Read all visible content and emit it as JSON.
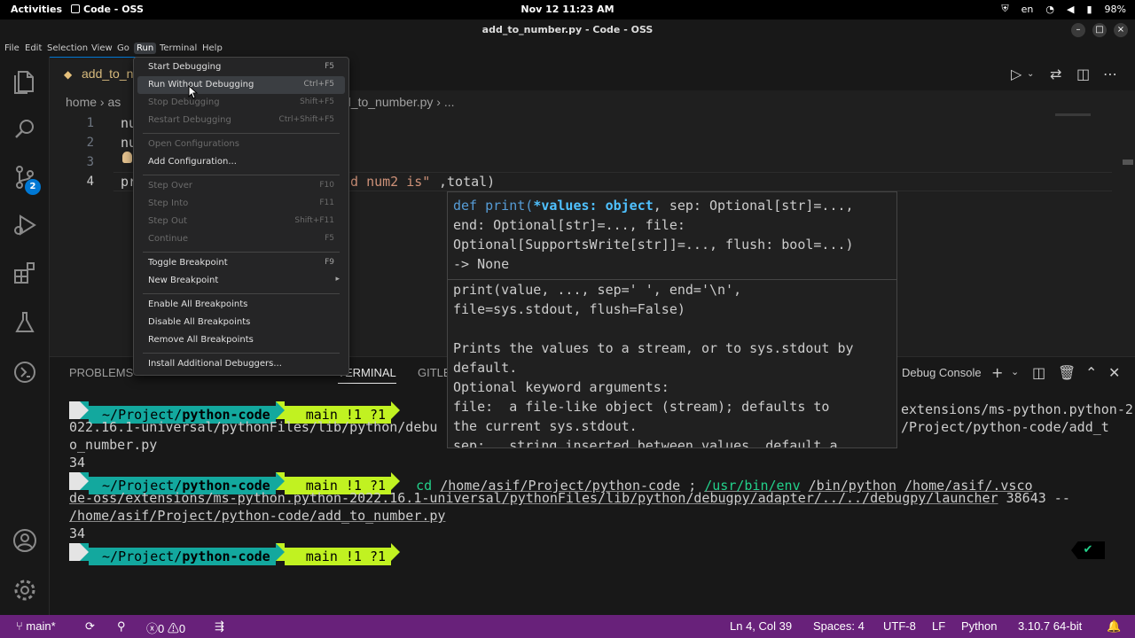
{
  "topbar": {
    "activities": "Activities",
    "app_name": "Code - OSS",
    "clock": "Nov 12  11:23 AM",
    "lang": "en",
    "battery": "98%"
  },
  "window": {
    "title": "add_to_number.py - Code - OSS",
    "minimize": "–",
    "maximize": "□",
    "close": "×"
  },
  "menubar": {
    "items": [
      "File",
      "Edit",
      "Selection",
      "View",
      "Go",
      "Run",
      "Terminal",
      "Help"
    ],
    "active": "Run"
  },
  "activitybar": {
    "scm_badge": "2"
  },
  "editor": {
    "tab_label": "add_to_n",
    "breadcrumb_home": "home",
    "breadcrumb_sep": "›",
    "breadcrumb_part": "as",
    "breadcrumb_file": "d_to_number.py",
    "breadcrumb_more": "...",
    "lines": [
      {
        "num": "1",
        "text": "nu"
      },
      {
        "num": "2",
        "text": "nu"
      },
      {
        "num": "3",
        "text": ""
      },
      {
        "num": "4",
        "text_start": "pr",
        "string_part": "nd num2 is\"",
        "rest": ",total)"
      }
    ]
  },
  "hover": {
    "sig_line1_a": "def print(",
    "sig_param": "*values: object",
    "sig_line1_b": ", sep: Optional[str]=...,",
    "sig_line2": "end: Optional[str]=..., file:",
    "sig_line3": "Optional[SupportsWrite[str]]=..., flush: bool=...)",
    "sig_line4": "-> None",
    "doc_lines": [
      "print(value, ..., sep=' ', end='\\n',",
      "file=sys.stdout, flush=False)",
      "",
      "Prints the values to a stream, or to sys.stdout by",
      "default.",
      "Optional keyword arguments:",
      "file:  a file-like object (stream); defaults to",
      "the current sys.stdout.",
      "sep:   string inserted between values, default a"
    ]
  },
  "panel": {
    "tabs": {
      "problems": "PROBLEMS",
      "terminal": "TERMINAL",
      "gitlens": "GITLE"
    },
    "debug_console": "Debug Console",
    "add_icon": "+",
    "dropdown_icon": "⌄",
    "prompt": {
      "os_icon": "",
      "folder_icon": "",
      "path_prefix": "~/Project/",
      "path_dir": "python-code",
      "git_icon": "",
      "branch_icon": "",
      "branch": "main !1 ?1"
    },
    "term_line1_tail": "extensions/ms-python.python-2",
    "term_line2a": "022.16.1-universal/pythonFiles/lib/python/debu",
    "term_line2b": "/Project/python-code/add_t",
    "term_line3": "o_number.py",
    "output1": "34",
    "cmd_cd": "cd",
    "cmd_cd_path": "/home/asif/Project/python-code",
    "cmd_semi": ";",
    "cmd_env": "/usr/bin/env",
    "cmd_python": "/bin/python",
    "cmd_vsco": "/home/asif/.vsco",
    "cmd_line2": "de-oss/extensions/ms-python.python-2022.16.1-universal/pythonFiles/lib/python/debugpy/adapter/../../debugpy/launcher",
    "cmd_port": "38643 --",
    "cmd_line3": "/home/asif/Project/python-code/add_to_number.py",
    "output2": "34",
    "check": "✔"
  },
  "statusbar": {
    "branch": "main*",
    "errors": "0",
    "warnings": "0",
    "position": "Ln 4, Col 39",
    "spaces": "Spaces: 4",
    "encoding": "UTF-8",
    "eol": "LF",
    "language": "Python",
    "interpreter": "3.10.7 64-bit"
  },
  "runmenu": {
    "items": [
      {
        "label": "Start Debugging",
        "key": "F5",
        "enabled": true
      },
      {
        "label": "Run Without Debugging",
        "key": "Ctrl+F5",
        "enabled": true,
        "highlighted": true
      },
      {
        "label": "Stop Debugging",
        "key": "Shift+F5",
        "enabled": false
      },
      {
        "label": "Restart Debugging",
        "key": "Ctrl+Shift+F5",
        "enabled": false
      },
      {
        "label": "Open Configurations",
        "key": "",
        "enabled": false
      },
      {
        "label": "Add Configuration...",
        "key": "",
        "enabled": true
      },
      {
        "label": "Step Over",
        "key": "F10",
        "enabled": false
      },
      {
        "label": "Step Into",
        "key": "F11",
        "enabled": false
      },
      {
        "label": "Step Out",
        "key": "Shift+F11",
        "enabled": false
      },
      {
        "label": "Continue",
        "key": "F5",
        "enabled": false
      },
      {
        "label": "Toggle Breakpoint",
        "key": "F9",
        "enabled": true
      },
      {
        "label": "New Breakpoint",
        "key": "",
        "enabled": true,
        "submenu": true
      },
      {
        "label": "Enable All Breakpoints",
        "key": "",
        "enabled": true
      },
      {
        "label": "Disable All Breakpoints",
        "key": "",
        "enabled": true
      },
      {
        "label": "Remove All Breakpoints",
        "key": "",
        "enabled": true
      },
      {
        "label": "Install Additional Debuggers...",
        "key": "",
        "enabled": true
      }
    ]
  },
  "colors": {
    "statusbar": "#68217a",
    "accent": "#0078d4",
    "prompt_teal": "#13a89e",
    "prompt_lime": "#c1f221"
  }
}
